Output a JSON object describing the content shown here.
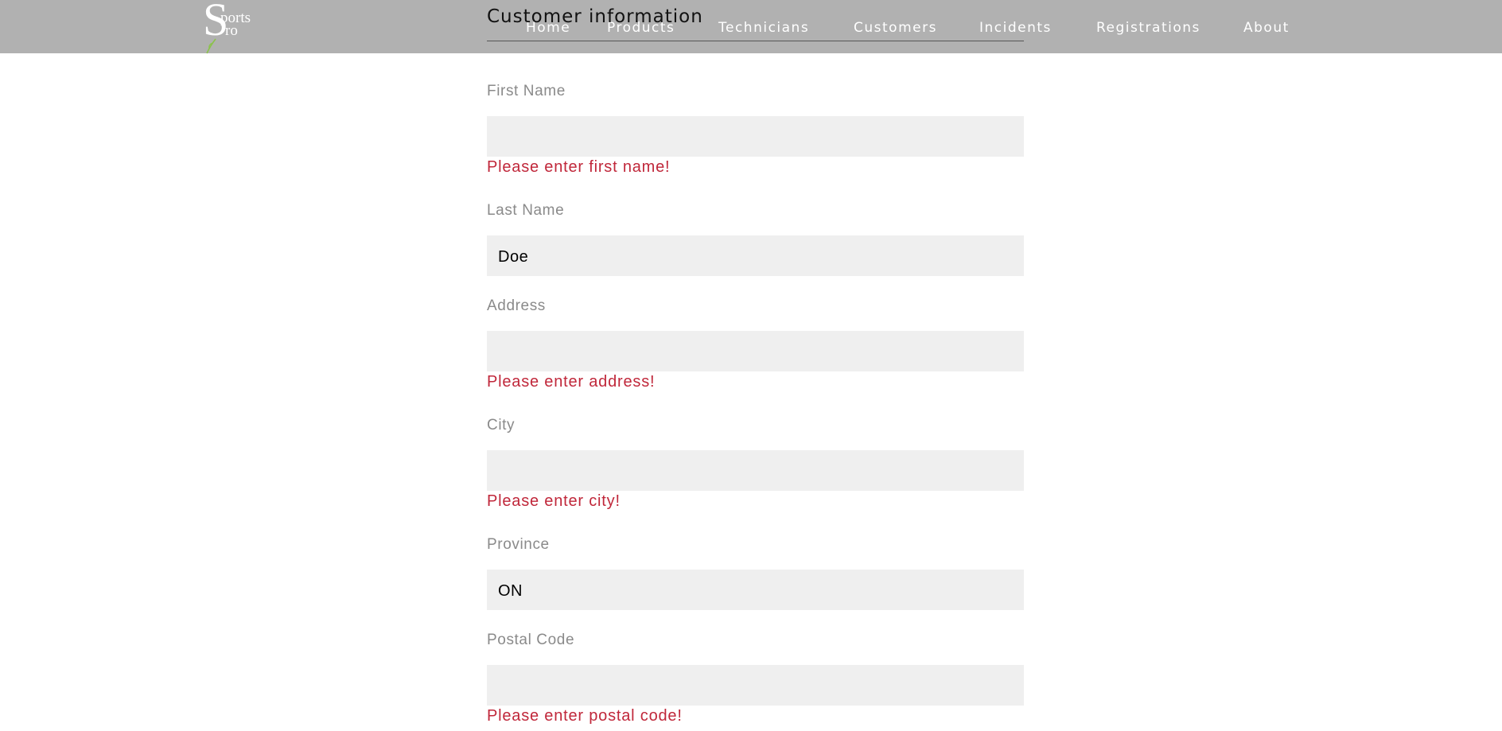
{
  "brand": {
    "big_letter": "S",
    "line1": "ports",
    "line2": "ro"
  },
  "page": {
    "title": "Customer information"
  },
  "nav": {
    "items": [
      {
        "label": "Home"
      },
      {
        "label": "Products"
      },
      {
        "label": "Technicians"
      },
      {
        "label": "Customers"
      },
      {
        "label": "Incidents"
      },
      {
        "label": "Registrations"
      },
      {
        "label": "About"
      }
    ]
  },
  "form": {
    "first_name": {
      "label": "First Name",
      "value": "",
      "error": "Please enter first name!"
    },
    "last_name": {
      "label": "Last Name",
      "value": "Doe"
    },
    "address": {
      "label": "Address",
      "value": "",
      "error": "Please enter address!"
    },
    "city": {
      "label": "City",
      "value": "",
      "error": "Please enter city!"
    },
    "province": {
      "label": "Province",
      "value": "ON"
    },
    "postal_code": {
      "label": "Postal Code",
      "value": "",
      "error": "Please enter postal code!"
    }
  },
  "colors": {
    "header_bg": "#b1b1b1",
    "field_bg": "#efefef",
    "error": "#c0273a",
    "label": "#8a8a8a",
    "leaf": "#8bc34a"
  }
}
